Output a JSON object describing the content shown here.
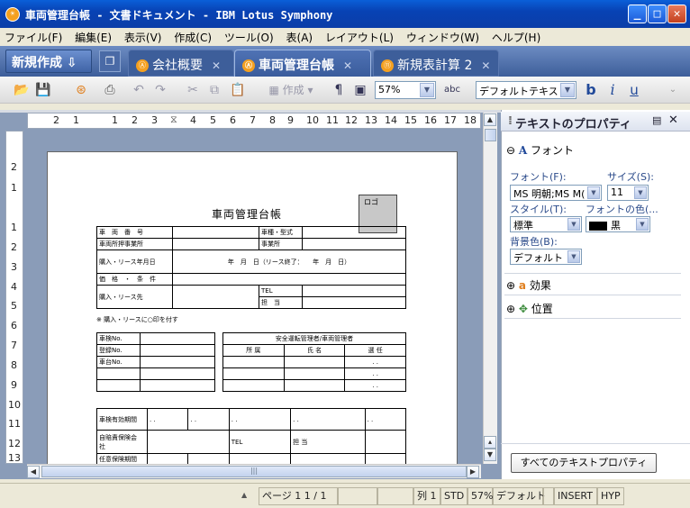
{
  "window": {
    "title": "車両管理台帳 - 文書ドキュメント - IBM Lotus Symphony",
    "icon_text": "☀"
  },
  "menu": [
    "ファイル(F)",
    "編集(E)",
    "表示(V)",
    "作成(C)",
    "ツール(O)",
    "表(A)",
    "レイアウト(L)",
    "ウィンドウ(W)",
    "ヘルプ(H)"
  ],
  "tabbar": {
    "new_label": "新規作成",
    "tabs": [
      {
        "label": "会社概要",
        "icon": "document-icon"
      },
      {
        "label": "車両管理台帳",
        "icon": "document-icon"
      },
      {
        "label": "新規表計算 2",
        "icon": "spreadsheet-icon"
      }
    ]
  },
  "toolbar": {
    "create_label": "作成",
    "zoom": "57%",
    "style": "デフォルトテキスト"
  },
  "ruler": {
    "h_ticks": [
      "2",
      "1",
      "1",
      "2",
      "3",
      "4",
      "5",
      "6",
      "7",
      "8",
      "9",
      "10",
      "11",
      "12",
      "13",
      "14",
      "15",
      "16",
      "17",
      "18"
    ],
    "v_ticks": [
      "2",
      "1",
      "1",
      "2",
      "3",
      "4",
      "5",
      "6",
      "7",
      "8",
      "9",
      "10",
      "11",
      "12",
      "13"
    ]
  },
  "document": {
    "title": "車両管理台帳",
    "logo": "ロゴ",
    "rows1": [
      [
        "車　両　番　号",
        "",
        "車種・型式",
        ""
      ],
      [
        "車両所押事業所",
        "",
        "事業所",
        ""
      ],
      [
        "購入・リース年月日",
        "年　月　日（リース終了：　　年　月　日）"
      ],
      [
        "価　格　・　条　件",
        ""
      ],
      [
        "購入・リース先",
        "",
        "TEL",
        ""
      ],
      [
        "",
        "",
        "担　当",
        ""
      ]
    ],
    "note": "※ 購入・リースに○印を付す",
    "left_rows": [
      "車検No.",
      "登録No.",
      "車台No.",
      "",
      ""
    ],
    "right_title": "安全運転管理者/車両管理者",
    "right_headers": [
      "所 属",
      "氏 名",
      "選 任"
    ],
    "dots": ". .",
    "bottom_rows": [
      "車検有効期間",
      "自賠責保険会　社",
      "任意保険期間"
    ],
    "tel": "TEL",
    "tanto": "担 当"
  },
  "panel": {
    "title": "テキストのプロパティ",
    "font_section": "フォント",
    "font_label": "フォント(F):",
    "font_value": "MS 明朝;MS M(",
    "size_label": "サイズ(S):",
    "size_value": "11",
    "style_label": "スタイル(T):",
    "style_value": "標準",
    "color_label": "フォントの色(...",
    "color_value": "黒",
    "bg_label": "背景色(B):",
    "bg_value": "デフォルト",
    "effects": "効果",
    "position": "位置",
    "all_button": "すべてのテキストプロパティ"
  },
  "status": {
    "page": "ページ 1  1 / 1",
    "col": "列 1",
    "std": "STD",
    "zoom": "57%",
    "style": "デフォルト",
    "insert": "INSERT",
    "hyp": "HYP"
  },
  "colors": {
    "accent": "#0842b4",
    "tabbar": "#3d5e9a"
  }
}
